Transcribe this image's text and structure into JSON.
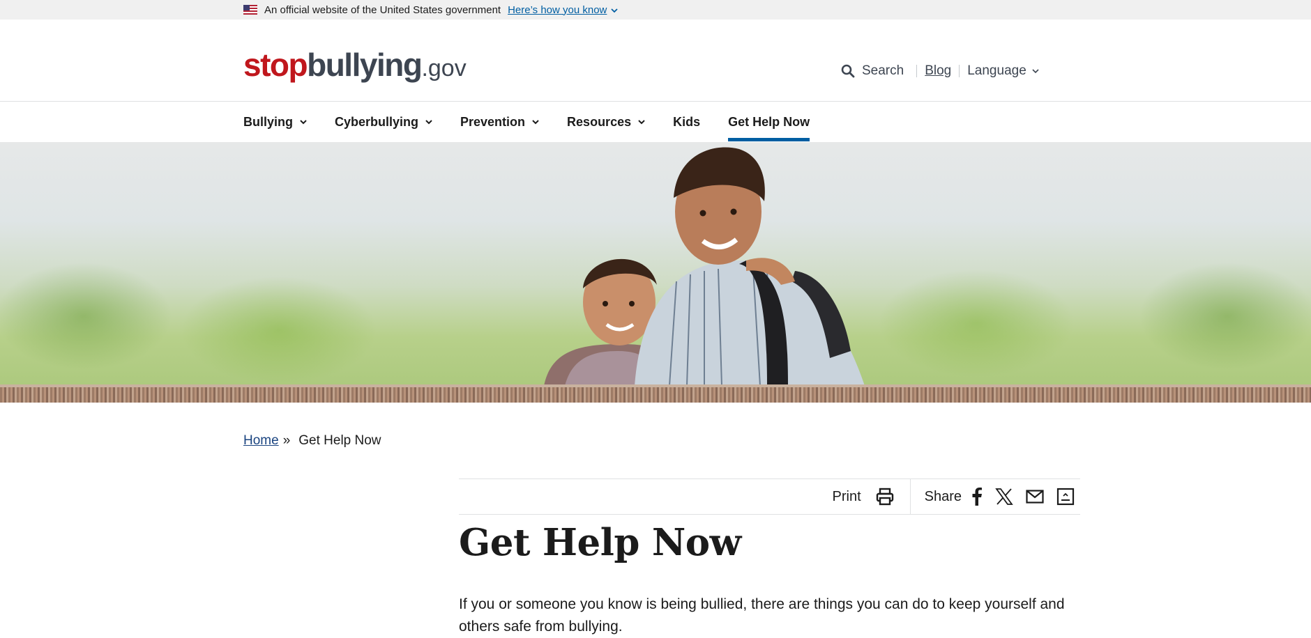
{
  "gov_banner": {
    "official_text": "An official website of the United States government",
    "how_link": "Here’s how you know"
  },
  "logo": {
    "part1": "stop",
    "part2": "bullying",
    "part3": ".gov"
  },
  "utility": {
    "search": "Search",
    "blog": "Blog",
    "language": "Language"
  },
  "nav": [
    {
      "label": "Bullying",
      "dropdown": true
    },
    {
      "label": "Cyberbullying",
      "dropdown": true
    },
    {
      "label": "Prevention",
      "dropdown": true
    },
    {
      "label": "Resources",
      "dropdown": true
    },
    {
      "label": "Kids",
      "dropdown": false
    },
    {
      "label": "Get Help Now",
      "dropdown": false,
      "active": true
    }
  ],
  "breadcrumb": {
    "home": "Home",
    "separator": "»",
    "current": "Get Help Now"
  },
  "share_bar": {
    "print": "Print",
    "share": "Share"
  },
  "page": {
    "title": "Get Help Now",
    "intro": "If you or someone you know is being bullied, there are things you can do to keep yourself and others safe from bullying."
  },
  "colors": {
    "brand_red": "#c0171d",
    "link_blue": "#005ea2",
    "active_tab": "#005ea2"
  },
  "icons": [
    "us-flag-icon",
    "search-icon",
    "chevron-down-icon",
    "print-icon",
    "facebook-icon",
    "x-twitter-icon",
    "email-icon",
    "bookmark-icon"
  ]
}
